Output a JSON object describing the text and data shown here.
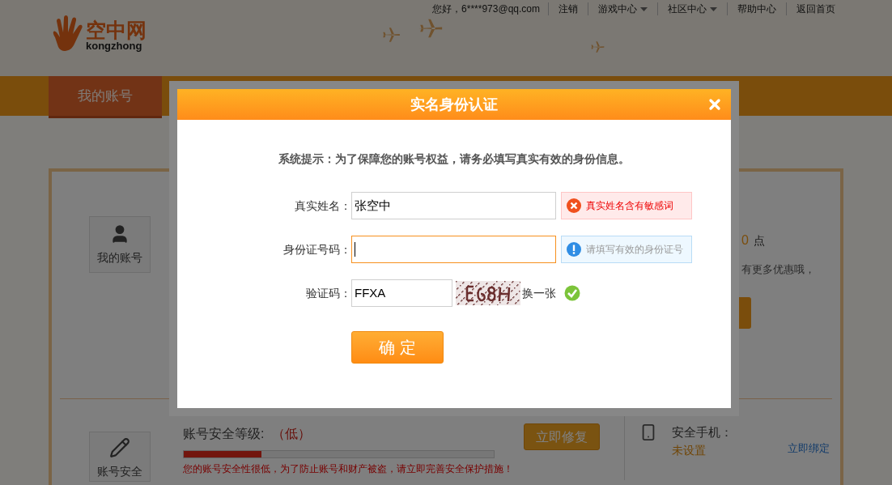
{
  "header": {
    "logo": {
      "mark": "空中网",
      "sub": "kongzhong"
    },
    "greeting": "您好，6****973@qq.com",
    "nav": [
      {
        "label": "注销",
        "dropdown": false
      },
      {
        "label": "游戏中心",
        "dropdown": true
      },
      {
        "label": "社区中心",
        "dropdown": true
      },
      {
        "label": "帮助中心",
        "dropdown": false
      },
      {
        "label": "返回首页",
        "dropdown": false
      }
    ]
  },
  "main_tabs": [
    {
      "label": "我的账号",
      "selected": true
    }
  ],
  "sidebar_cards": [
    {
      "label": "我的账号",
      "kind": "user"
    },
    {
      "label": "账号安全",
      "kind": "pencil"
    }
  ],
  "account_summary": {
    "points": "0",
    "points_unit": "点",
    "promo": "有更多优惠哦，"
  },
  "security": {
    "title": "账号安全等级:",
    "grade": "（低）",
    "level": 0.25,
    "warning": "您的账号安全性很低，为了防止账号和财产被盗，请立即完善安全保护措施！",
    "fix_button": "立即修复",
    "phone": {
      "label": "安全手机：",
      "status": "未设置",
      "action": "立即绑定"
    }
  },
  "dialog": {
    "title": "实名身份认证",
    "prompt": "系统提示：为了保障您的账号权益，请务必填写真实有效的身份信息。",
    "fields": [
      {
        "kind": "text",
        "label": "真实姓名：",
        "value": "张空中",
        "focused": false,
        "tip": {
          "kind": "error",
          "text": "真实姓名含有敏感词"
        }
      },
      {
        "kind": "text",
        "label": "身份证号码：",
        "focused": true,
        "tip": {
          "kind": "info",
          "text": "请填写有效的身份证号"
        }
      },
      {
        "kind": "captcha",
        "label": "验证码：",
        "value": "FFXA",
        "refresh": "换一张",
        "valid": true
      }
    ],
    "submit": "确 定"
  }
}
